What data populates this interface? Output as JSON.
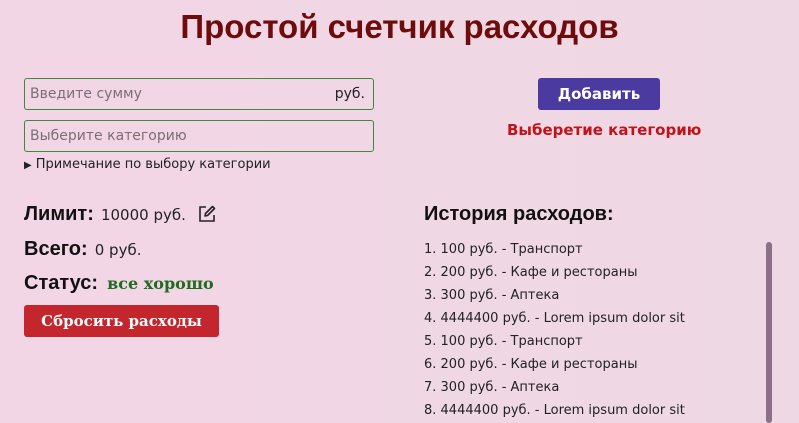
{
  "title": "Простой счетчик расходов",
  "form": {
    "amount_placeholder": "Введите сумму",
    "amount_suffix": "руб.",
    "category_placeholder": "Выберите категорию",
    "note_label": "Примечание по выбору категории",
    "add_label": "Добавить",
    "warning": "Выберетие категорию"
  },
  "stats": {
    "limit_label": "Лимит:",
    "limit_value": "10000 руб.",
    "total_label": "Всего:",
    "total_value": "0 руб.",
    "status_label": "Статус:",
    "status_value": "все хорошо",
    "reset_label": "Сбросить расходы"
  },
  "history": {
    "title": "История расходов:",
    "items": [
      "1. 100 руб. - Транспорт",
      "2. 200 руб. - Кафе и рестораны",
      "3. 300 руб. - Аптека",
      "4. 4444400 руб. - Lorem ipsum dolor sit",
      "5. 100 руб. - Транспорт",
      "6. 200 руб. - Кафе и рестораны",
      "7. 300 руб. - Аптека",
      "8. 4444400 руб. - Lorem ipsum dolor sit"
    ]
  },
  "colors": {
    "title": "#6e0b0b",
    "accent_button": "#4b3aa0",
    "reset_button": "#c3262c",
    "warning": "#c2121a",
    "status_ok": "#1f6b1f",
    "input_border": "#3c8a3c"
  },
  "icons": {
    "edit": "edit-icon",
    "disclosure": "triangle-right-icon"
  }
}
